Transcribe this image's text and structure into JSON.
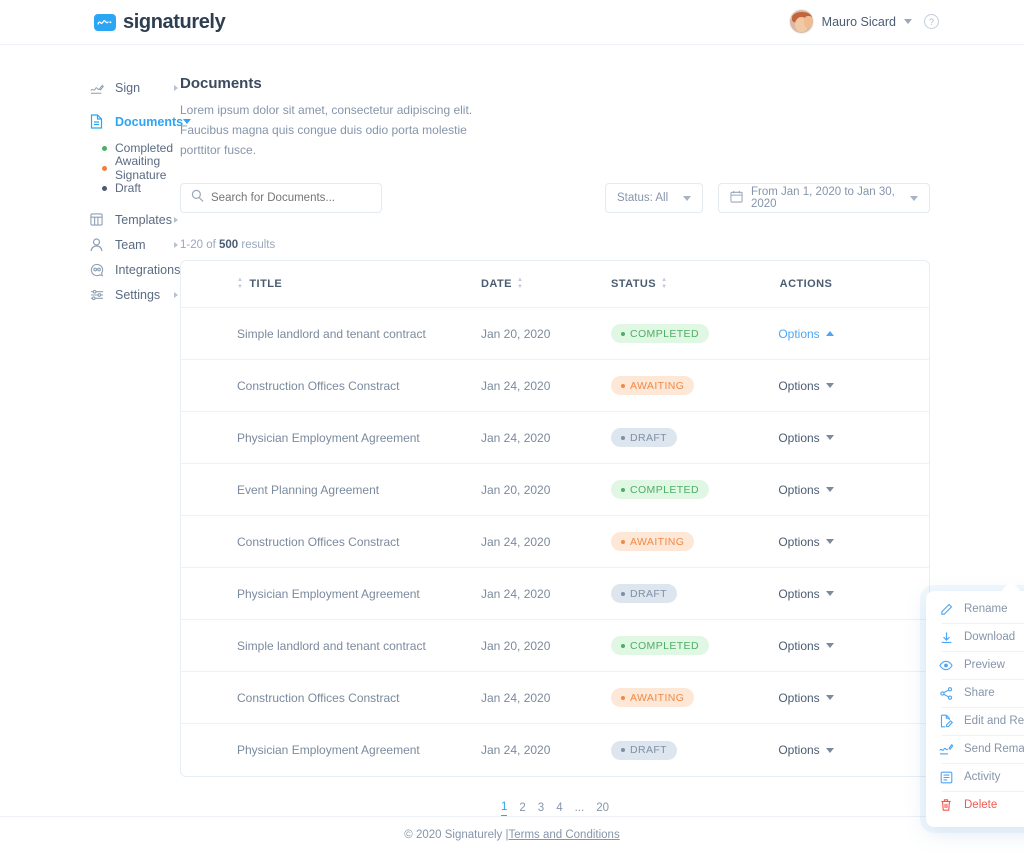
{
  "header": {
    "brand": "signaturely",
    "brand_icon": "signature-logo-icon",
    "user_name": "Mauro Sicard",
    "help_label": "?"
  },
  "sidebar": {
    "items": [
      {
        "label": "Sign",
        "icon": "sign-pen-icon",
        "state": "collapsed"
      },
      {
        "label": "Documents",
        "icon": "document-icon",
        "state": "expanded"
      },
      {
        "label": "Templates",
        "icon": "templates-icon",
        "state": "collapsed"
      },
      {
        "label": "Team",
        "icon": "user-icon",
        "state": "collapsed"
      },
      {
        "label": "Integrations",
        "icon": "integrations-icon",
        "state": "collapsed"
      },
      {
        "label": "Settings",
        "icon": "settings-sliders-icon",
        "state": "collapsed"
      }
    ],
    "sub_items": [
      {
        "label": "Completed",
        "color": "#4caf63"
      },
      {
        "label": "Awaiting Signature",
        "color": "#f0803c"
      },
      {
        "label": "Draft",
        "color": "#4b5c72"
      }
    ]
  },
  "main": {
    "title": "Documents",
    "description": "Lorem ipsum dolor sit amet, consectetur adipiscing elit. Faucibus magna quis congue duis odio porta molestie porttitor fusce.",
    "search": {
      "placeholder": "Search for Documents...",
      "value": "",
      "icon": "search-icon"
    },
    "status_filter": {
      "label": "Status: All"
    },
    "date_filter": {
      "label": "From Jan 1, 2020 to Jan  30, 2020",
      "icon": "calendar-icon"
    },
    "result_count": {
      "range": "1-20 of ",
      "total": "500",
      "suffix": " results"
    }
  },
  "table": {
    "columns": [
      {
        "key": "title",
        "label": "TITLE",
        "sortable": true,
        "sort_side": "before"
      },
      {
        "key": "date",
        "label": "DATE",
        "sortable": true,
        "sort_side": "after"
      },
      {
        "key": "status",
        "label": "STATUS",
        "sortable": true,
        "sort_side": "after"
      },
      {
        "key": "actions",
        "label": "ACTIONS",
        "sortable": false
      }
    ],
    "options_label": "Options",
    "rows": [
      {
        "title": "Simple landlord and tenant contract",
        "date": "Jan 20, 2020",
        "status": "COMPLETED",
        "status_type": "completed",
        "menu_open": true
      },
      {
        "title": "Construction Offices Constract",
        "date": "Jan 24, 2020",
        "status": "AWAITING",
        "status_type": "awaiting",
        "menu_open": false
      },
      {
        "title": "Physician Employment Agreement",
        "date": "Jan 24, 2020",
        "status": "DRAFT",
        "status_type": "draft",
        "menu_open": false
      },
      {
        "title": "Event Planning Agreement",
        "date": "Jan 20, 2020",
        "status": "COMPLETED",
        "status_type": "completed",
        "menu_open": false
      },
      {
        "title": "Construction Offices Constract",
        "date": "Jan 24, 2020",
        "status": "AWAITING",
        "status_type": "awaiting",
        "menu_open": false
      },
      {
        "title": "Physician Employment Agreement",
        "date": "Jan 24, 2020",
        "status": "DRAFT",
        "status_type": "draft",
        "menu_open": false
      },
      {
        "title": "Simple landlord and tenant contract",
        "date": "Jan 20, 2020",
        "status": "COMPLETED",
        "status_type": "completed",
        "menu_open": false
      },
      {
        "title": "Construction Offices Constract",
        "date": "Jan 24, 2020",
        "status": "AWAITING",
        "status_type": "awaiting",
        "menu_open": false
      },
      {
        "title": "Physician Employment Agreement",
        "date": "Jan 24, 2020",
        "status": "DRAFT",
        "status_type": "draft",
        "menu_open": false
      }
    ]
  },
  "options_menu": {
    "items": [
      {
        "label": "Rename",
        "icon": "pencil-icon",
        "danger": false
      },
      {
        "label": "Download",
        "icon": "download-arrow-icon",
        "danger": false
      },
      {
        "label": "Preview",
        "icon": "eye-icon",
        "danger": false
      },
      {
        "label": "Share",
        "icon": "share-nodes-icon",
        "danger": false
      },
      {
        "label": "Edit and Resend",
        "icon": "edit-document-icon",
        "danger": false
      },
      {
        "label": "Send Remainder",
        "icon": "send-reminder-icon",
        "danger": false
      },
      {
        "label": "Activity",
        "icon": "activity-list-icon",
        "danger": false
      },
      {
        "label": "Delete",
        "icon": "trash-icon",
        "danger": true
      }
    ]
  },
  "pagination": {
    "pages": [
      "1",
      "2",
      "3",
      "4",
      "...",
      "20"
    ],
    "active": "1"
  },
  "footer": {
    "copyright": "© 2020 Signaturely | ",
    "terms": "Terms and Conditions"
  },
  "colors": {
    "accent": "#2ba6f5",
    "text": "#5b6b82",
    "completed": "#4caf63",
    "awaiting": "#f0803c",
    "draft": "#7f8fa6",
    "danger": "#f3574e"
  }
}
